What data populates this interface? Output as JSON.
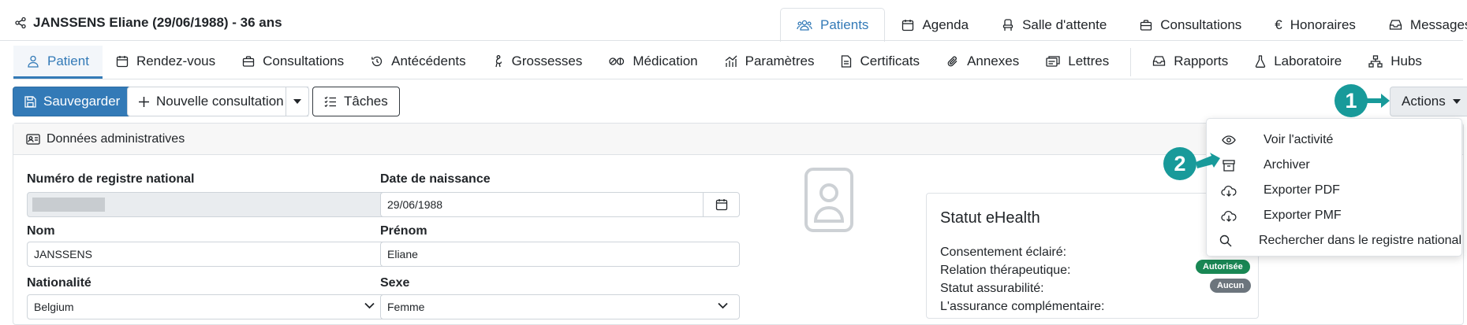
{
  "patient": {
    "header": "JANSSENS Eliane (29/06/1988) - 36 ans"
  },
  "top_tabs": [
    {
      "label": "Patients",
      "icon": "users-icon",
      "active": true
    },
    {
      "label": "Agenda",
      "icon": "calendar-icon"
    },
    {
      "label": "Salle d'attente",
      "icon": "chair-icon"
    },
    {
      "label": "Consultations",
      "icon": "briefcase-icon"
    },
    {
      "label": "Honoraires",
      "icon": "euro-icon"
    },
    {
      "label": "Messages",
      "icon": "inbox-icon"
    }
  ],
  "sub_tabs": [
    {
      "label": "Patient",
      "icon": "user-icon",
      "active": true
    },
    {
      "label": "Rendez-vous",
      "icon": "calendar-icon"
    },
    {
      "label": "Consultations",
      "icon": "briefcase-icon"
    },
    {
      "label": "Antécédents",
      "icon": "history-icon"
    },
    {
      "label": "Grossesses",
      "icon": "pregnancy-icon"
    },
    {
      "label": "Médication",
      "icon": "pills-icon"
    },
    {
      "label": "Paramètres",
      "icon": "chart-icon"
    },
    {
      "label": "Certificats",
      "icon": "document-icon"
    },
    {
      "label": "Annexes",
      "icon": "paperclip-icon"
    },
    {
      "label": "Lettres",
      "icon": "letters-icon"
    },
    {
      "label": "Rapports",
      "icon": "inbox-icon"
    },
    {
      "label": "Laboratoire",
      "icon": "flask-icon"
    },
    {
      "label": "Hubs",
      "icon": "sitemap-icon"
    }
  ],
  "toolbar": {
    "save_label": "Sauvegarder",
    "new_consult_label": "Nouvelle consultation",
    "tasks_label": "Tâches",
    "actions_label": "Actions"
  },
  "steps": {
    "one": "1",
    "two": "2"
  },
  "actions_menu": [
    {
      "label": "Voir l'activité",
      "icon": "eye-icon"
    },
    {
      "label": "Archiver",
      "icon": "archive-icon"
    },
    {
      "label": "Exporter PDF",
      "icon": "cloud-download-icon"
    },
    {
      "label": "Exporter PMF",
      "icon": "cloud-download-icon"
    },
    {
      "label": "Rechercher dans le registre national",
      "icon": "search-icon"
    }
  ],
  "admin": {
    "title": "Données administratives",
    "nrn_label": "Numéro de registre national",
    "nrn_value": "",
    "birth_label": "Date de naissance",
    "birth_value": "29/06/1988",
    "nom_label": "Nom",
    "nom_value": "JANSSENS",
    "prenom_label": "Prénom",
    "prenom_value": "Eliane",
    "nat_label": "Nationalité",
    "nat_value": "Belgium",
    "sexe_label": "Sexe",
    "sexe_value": "Femme"
  },
  "ehealth": {
    "title": "Statut eHealth",
    "consent_label": "Consentement éclairé:",
    "relation_label": "Relation thérapeutique:",
    "insurability_label": "Statut assurabilité:",
    "insurability_badge": "Autorisée",
    "complementary_label": "L'assurance complémentaire:",
    "complementary_badge": "Aucun"
  },
  "colors": {
    "primary": "#337ab7",
    "step": "#189a9a",
    "success": "#198754",
    "secondary": "#6c757d"
  }
}
